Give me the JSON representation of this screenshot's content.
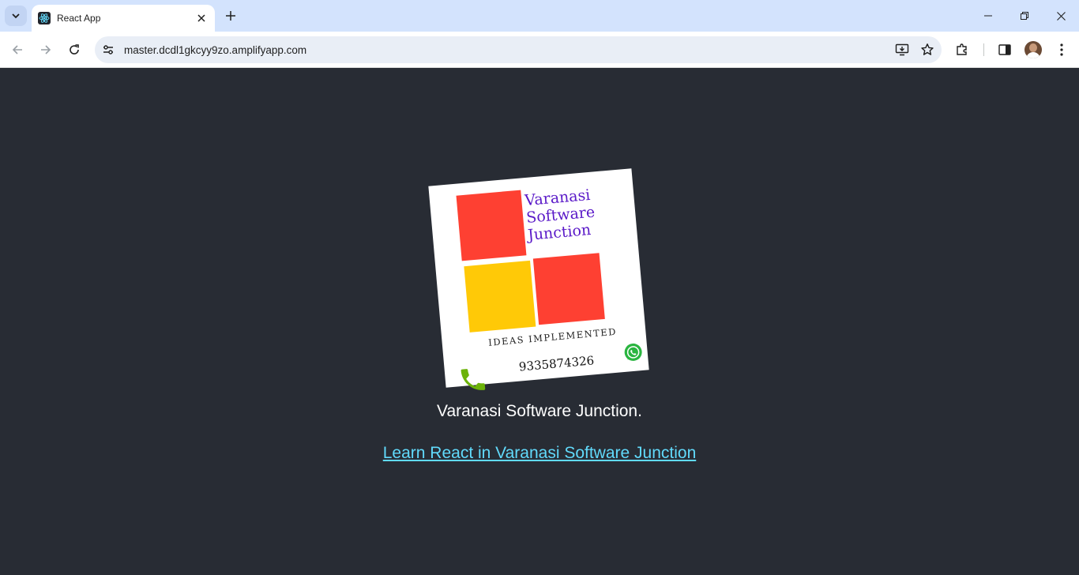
{
  "browser": {
    "tab_title": "React App",
    "url": "master.dcdl1gkcyy9zo.amplifyapp.com"
  },
  "page": {
    "logo": {
      "brand_line1": "Varanasi",
      "brand_line2": "Software",
      "brand_line3": "Junction",
      "tagline": "IDEAS IMPLEMENTED",
      "phone": "9335874326",
      "colors": {
        "red": "#fe4032",
        "yellow": "#ffc907",
        "purple": "#5a19c8"
      }
    },
    "caption": "Varanasi Software Junction.",
    "link_text": "Learn React in Varanasi Software Junction",
    "link_color": "#61dafb",
    "background": "#282c34"
  }
}
